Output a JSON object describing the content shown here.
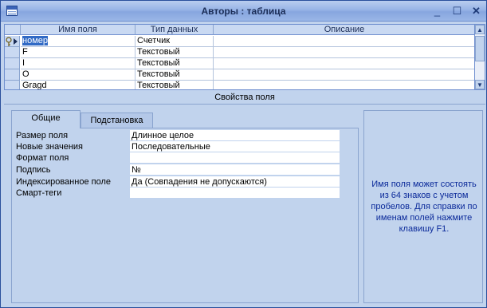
{
  "window": {
    "title": "Авторы : таблица",
    "minimize_glyph": "_",
    "maximize_glyph": "☐",
    "close_glyph": "✕",
    "icon": "table-icon"
  },
  "grid": {
    "columns": [
      "Имя поля",
      "Тип данных",
      "Описание"
    ],
    "rows": [
      {
        "name": "номер",
        "type": "Счетчик",
        "description": "",
        "key": true,
        "current": true
      },
      {
        "name": "F",
        "type": "Текстовый",
        "description": ""
      },
      {
        "name": "I",
        "type": "Текстовый",
        "description": ""
      },
      {
        "name": "O",
        "type": "Текстовый",
        "description": ""
      },
      {
        "name": "Gragd",
        "type": "Текстовый",
        "description": ""
      }
    ]
  },
  "properties": {
    "section_title": "Свойства поля",
    "tabs": [
      {
        "label": "Общие",
        "active": true
      },
      {
        "label": "Подстановка",
        "active": false
      }
    ],
    "rows": [
      {
        "label": "Размер поля",
        "value": "Длинное целое"
      },
      {
        "label": "Новые значения",
        "value": "Последовательные"
      },
      {
        "label": "Формат поля",
        "value": ""
      },
      {
        "label": "Подпись",
        "value": "№"
      },
      {
        "label": "Индексированное поле",
        "value": "Да (Совпадения не допускаются)"
      },
      {
        "label": "Смарт-теги",
        "value": ""
      }
    ],
    "help_text": "Имя поля может состоять из 64 знаков с учетом пробелов.  Для справки по именам полей нажмите клавишу F1."
  },
  "colors": {
    "window_bg": "#c1d3ed",
    "selection": "#316ac5",
    "help_text": "#0b2a9a"
  }
}
